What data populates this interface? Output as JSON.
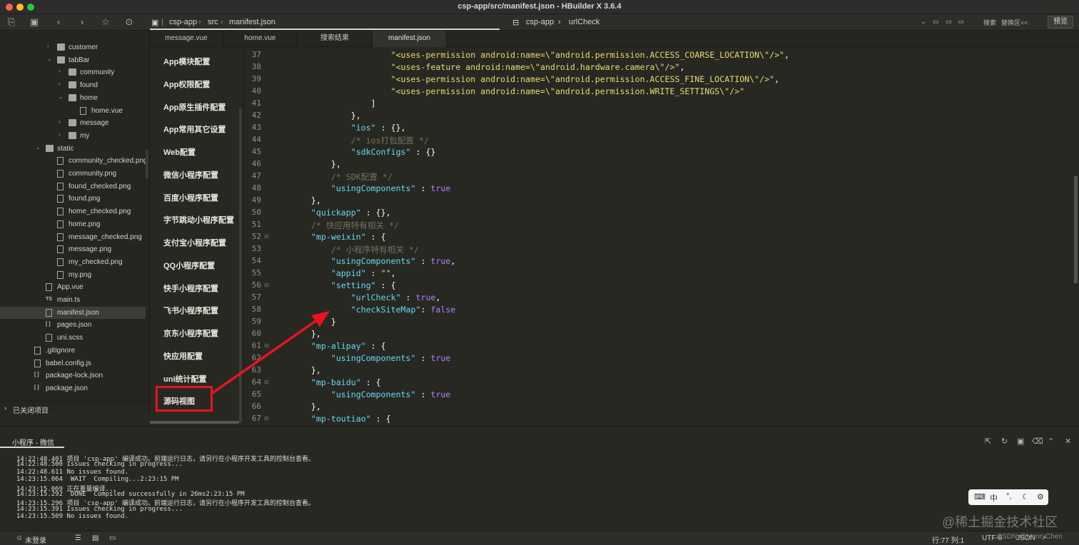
{
  "window": {
    "title": "csp-app/src/manifest.json - HBuilder X 3.6.4"
  },
  "breadcrumb": {
    "project": "csp-app",
    "folder": "src",
    "file": "manifest.json"
  },
  "symbol_crumb": {
    "project": "csp-app",
    "symbol": "urlCheck"
  },
  "search": {
    "search_label": "搜索",
    "replace_label": "替换区<<"
  },
  "preview_button": "预览",
  "filetree": [
    {
      "label": "customer",
      "type": "folder",
      "indent": 3,
      "arrow": "›"
    },
    {
      "label": "tabBar",
      "type": "folder",
      "indent": 3,
      "arrow": "⌄"
    },
    {
      "label": "community",
      "type": "folder",
      "indent": 4,
      "arrow": "›"
    },
    {
      "label": "found",
      "type": "folder",
      "indent": 4,
      "arrow": "›"
    },
    {
      "label": "home",
      "type": "folder",
      "indent": 4,
      "arrow": "⌄"
    },
    {
      "label": "home.vue",
      "type": "file",
      "indent": 5,
      "arrow": ""
    },
    {
      "label": "message",
      "type": "folder",
      "indent": 4,
      "arrow": "›"
    },
    {
      "label": "my",
      "type": "folder",
      "indent": 4,
      "arrow": "›"
    },
    {
      "label": "static",
      "type": "folder",
      "indent": 2,
      "arrow": "⌄"
    },
    {
      "label": "community_checked.png",
      "type": "img",
      "indent": 3,
      "arrow": ""
    },
    {
      "label": "community.png",
      "type": "img",
      "indent": 3,
      "arrow": ""
    },
    {
      "label": "found_checked.png",
      "type": "img",
      "indent": 3,
      "arrow": ""
    },
    {
      "label": "found.png",
      "type": "img",
      "indent": 3,
      "arrow": ""
    },
    {
      "label": "home_checked.png",
      "type": "img",
      "indent": 3,
      "arrow": ""
    },
    {
      "label": "home.png",
      "type": "img",
      "indent": 3,
      "arrow": ""
    },
    {
      "label": "message_checked.png",
      "type": "img",
      "indent": 3,
      "arrow": ""
    },
    {
      "label": "message.png",
      "type": "img",
      "indent": 3,
      "arrow": ""
    },
    {
      "label": "my_checked.png",
      "type": "img",
      "indent": 3,
      "arrow": ""
    },
    {
      "label": "my.png",
      "type": "img",
      "indent": 3,
      "arrow": ""
    },
    {
      "label": "App.vue",
      "type": "file",
      "indent": 2,
      "arrow": ""
    },
    {
      "label": "main.ts",
      "type": "ts",
      "indent": 2,
      "arrow": ""
    },
    {
      "label": "manifest.json",
      "type": "file",
      "indent": 2,
      "arrow": "",
      "selected": true
    },
    {
      "label": "pages.json",
      "type": "json",
      "indent": 2,
      "arrow": ""
    },
    {
      "label": "uni.scss",
      "type": "file",
      "indent": 2,
      "arrow": ""
    },
    {
      "label": ".gitignore",
      "type": "file",
      "indent": 1,
      "arrow": ""
    },
    {
      "label": "babel.config.js",
      "type": "file",
      "indent": 1,
      "arrow": ""
    },
    {
      "label": "package-lock.json",
      "type": "json",
      "indent": 1,
      "arrow": ""
    },
    {
      "label": "package.json",
      "type": "json",
      "indent": 1,
      "arrow": ""
    }
  ],
  "closed_projects_label": "已关闭项目",
  "tabs": [
    {
      "label": "message.vue",
      "active": false
    },
    {
      "label": "home.vue",
      "active": false
    },
    {
      "label": "搜索结果",
      "active": false
    },
    {
      "label": "manifest.json",
      "active": true
    }
  ],
  "config_nav": [
    "App模块配置",
    "App权限配置",
    "App原生插件配置",
    "App常用其它设置",
    "Web配置",
    "微信小程序配置",
    "百度小程序配置",
    "字节跳动小程序配置",
    "支付宝小程序配置",
    "QQ小程序配置",
    "快手小程序配置",
    "飞书小程序配置",
    "京东小程序配置",
    "快应用配置",
    "uni统计配置",
    "源码视图"
  ],
  "code": [
    {
      "n": "37",
      "fold": false,
      "segs": [
        [
          "s",
          "                    \"<uses-permission android:name=\\\"android.permission.ACCESS_COARSE_LOCATION\\\"/>\""
        ],
        [
          "p",
          ","
        ]
      ]
    },
    {
      "n": "38",
      "fold": false,
      "segs": [
        [
          "s",
          "                    \"<uses-feature android:name=\\\"android.hardware.camera\\\"/>\""
        ],
        [
          "p",
          ","
        ]
      ]
    },
    {
      "n": "39",
      "fold": false,
      "segs": [
        [
          "s",
          "                    \"<uses-permission android:name=\\\"android.permission.ACCESS_FINE_LOCATION\\\"/>\""
        ],
        [
          "p",
          ","
        ]
      ]
    },
    {
      "n": "40",
      "fold": false,
      "segs": [
        [
          "s",
          "                    \"<uses-permission android:name=\\\"android.permission.WRITE_SETTINGS\\\"/>\""
        ]
      ]
    },
    {
      "n": "41",
      "fold": false,
      "segs": [
        [
          "p",
          "                ]"
        ]
      ]
    },
    {
      "n": "42",
      "fold": false,
      "segs": [
        [
          "p",
          "            },"
        ]
      ]
    },
    {
      "n": "43",
      "fold": false,
      "segs": [
        [
          "k",
          "            \"ios\""
        ],
        [
          "p",
          " : {},"
        ]
      ]
    },
    {
      "n": "44",
      "fold": false,
      "segs": [
        [
          "c",
          "            /* ios打包配置 */"
        ]
      ]
    },
    {
      "n": "45",
      "fold": false,
      "segs": [
        [
          "k",
          "            \"sdkConfigs\""
        ],
        [
          "p",
          " : {}"
        ]
      ]
    },
    {
      "n": "46",
      "fold": false,
      "segs": [
        [
          "p",
          "        },"
        ]
      ]
    },
    {
      "n": "47",
      "fold": false,
      "segs": [
        [
          "c",
          "        /* SDK配置 */"
        ]
      ]
    },
    {
      "n": "48",
      "fold": false,
      "segs": [
        [
          "k",
          "        \"usingComponents\""
        ],
        [
          "p",
          " : "
        ],
        [
          "b",
          "true"
        ]
      ]
    },
    {
      "n": "49",
      "fold": false,
      "segs": [
        [
          "p",
          "    },"
        ]
      ]
    },
    {
      "n": "50",
      "fold": false,
      "segs": [
        [
          "k",
          "    \"quickapp\""
        ],
        [
          "p",
          " : {},"
        ]
      ]
    },
    {
      "n": "51",
      "fold": false,
      "segs": [
        [
          "c",
          "    /* 快应用特有相关 */"
        ]
      ]
    },
    {
      "n": "52",
      "fold": true,
      "segs": [
        [
          "k",
          "    \"mp-weixin\""
        ],
        [
          "p",
          " : {"
        ]
      ]
    },
    {
      "n": "53",
      "fold": false,
      "segs": [
        [
          "c",
          "        /* 小程序特有相关 */"
        ]
      ]
    },
    {
      "n": "54",
      "fold": false,
      "segs": [
        [
          "k",
          "        \"usingComponents\""
        ],
        [
          "p",
          " : "
        ],
        [
          "b",
          "true"
        ],
        [
          "p",
          ","
        ]
      ]
    },
    {
      "n": "55",
      "fold": false,
      "segs": [
        [
          "k",
          "        \"appid\""
        ],
        [
          "p",
          " : "
        ],
        [
          "s",
          "\"\""
        ],
        [
          "p",
          ","
        ]
      ]
    },
    {
      "n": "56",
      "fold": true,
      "segs": [
        [
          "k",
          "        \"setting\""
        ],
        [
          "p",
          " : {"
        ]
      ]
    },
    {
      "n": "57",
      "fold": false,
      "segs": [
        [
          "k",
          "            \"urlCheck\""
        ],
        [
          "p",
          " : "
        ],
        [
          "b",
          "true"
        ],
        [
          "p",
          ","
        ]
      ]
    },
    {
      "n": "58",
      "fold": false,
      "segs": [
        [
          "k",
          "            \"checkSiteMap\""
        ],
        [
          "p",
          ": "
        ],
        [
          "b",
          "false"
        ]
      ]
    },
    {
      "n": "59",
      "fold": false,
      "segs": [
        [
          "p",
          "        }"
        ]
      ]
    },
    {
      "n": "60",
      "fold": false,
      "segs": [
        [
          "p",
          "    },"
        ]
      ]
    },
    {
      "n": "61",
      "fold": true,
      "segs": [
        [
          "k",
          "    \"mp-alipay\""
        ],
        [
          "p",
          " : {"
        ]
      ]
    },
    {
      "n": "62",
      "fold": false,
      "segs": [
        [
          "k",
          "        \"usingComponents\""
        ],
        [
          "p",
          " : "
        ],
        [
          "b",
          "true"
        ]
      ]
    },
    {
      "n": "63",
      "fold": false,
      "segs": [
        [
          "p",
          "    },"
        ]
      ]
    },
    {
      "n": "64",
      "fold": true,
      "segs": [
        [
          "k",
          "    \"mp-baidu\""
        ],
        [
          "p",
          " : {"
        ]
      ]
    },
    {
      "n": "65",
      "fold": false,
      "segs": [
        [
          "k",
          "        \"usingComponents\""
        ],
        [
          "p",
          " : "
        ],
        [
          "b",
          "true"
        ]
      ]
    },
    {
      "n": "66",
      "fold": false,
      "segs": [
        [
          "p",
          "    },"
        ]
      ]
    },
    {
      "n": "67",
      "fold": true,
      "segs": [
        [
          "k",
          "    \"mp-toutiao\""
        ],
        [
          "p",
          " : {"
        ]
      ]
    }
  ],
  "console": {
    "title": "小程序 - 微信",
    "lines": [
      "14:22:48.401 项目 'csp-app' 编译成功。前端运行日志，请另行在小程序开发工具的控制台查看。",
      "14:22:48.500 Issues checking in progress...",
      "14:22:48.611 No issues found.",
      "14:23:15.064  WAIT  Compiling...2:23:15 PM",
      "14:23:15.069 正在差量编译...",
      "14:23:15.292  DONE  Compiled successfully in 26ms2:23:15 PM",
      "14:23:15.296 项目 'csp-app' 编译成功。前端运行日志，请另行在小程序开发工具的控制台查看。",
      "14:23:15.391 Issues checking in progress...",
      "14:23:15.509 No issues found."
    ]
  },
  "ime": {
    "lang": "中",
    "punct": "°,",
    "moon": "☾",
    "gear": "⚙",
    "logo": "⌨"
  },
  "watermark": "@稀土掘金技术社区",
  "csdn_mark": "CSDN @HenryChen",
  "statusbar": {
    "login": "未登录",
    "position": "行:77  列:1",
    "encoding": "UTF-8",
    "language": "JSON"
  },
  "colors": {
    "annotation": "#e8141e",
    "string": "#e6db74",
    "key": "#66d9ef",
    "bool": "#ae81ff",
    "comment": "#75715e"
  }
}
